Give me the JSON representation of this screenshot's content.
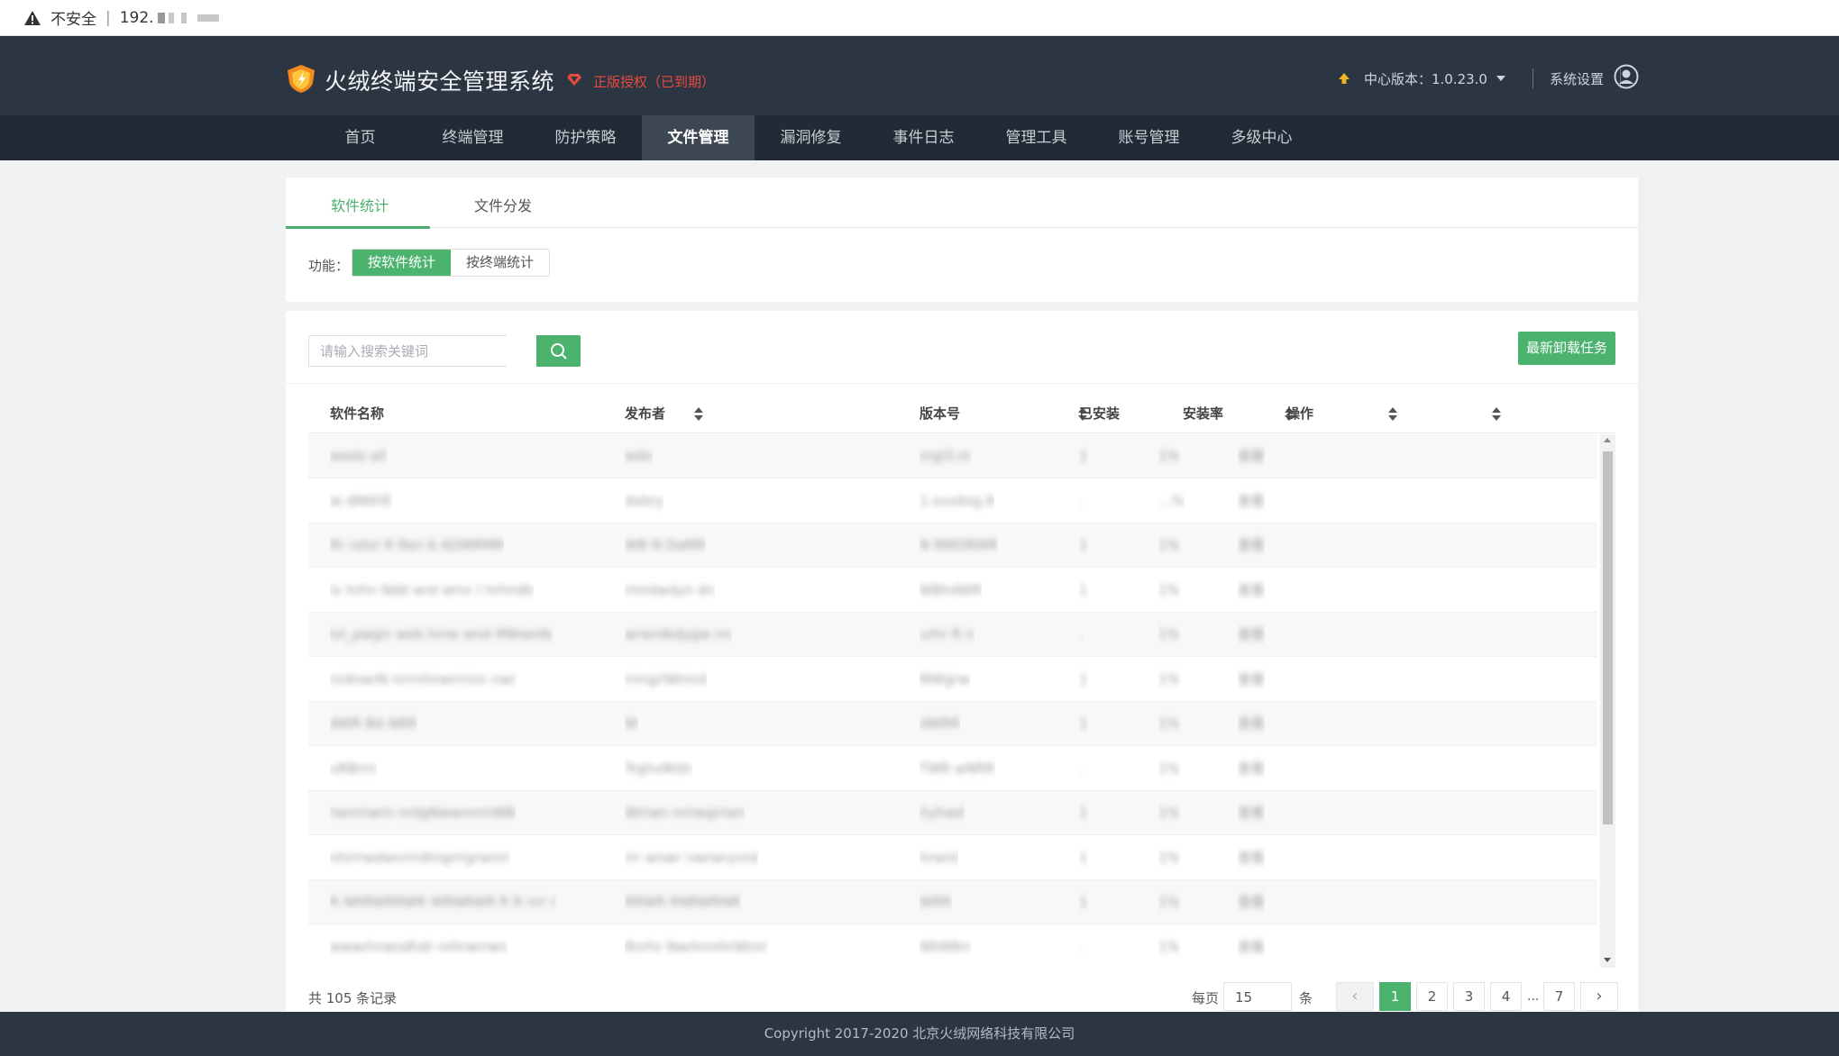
{
  "browser": {
    "security_label": "不安全",
    "url_prefix": "192."
  },
  "header": {
    "app_title": "火绒终端安全管理系统",
    "license_text": "正版授权（已到期）",
    "version_label": "中心版本：1.0.23.0",
    "settings_label": "系统设置"
  },
  "nav": {
    "items": [
      "首页",
      "终端管理",
      "防护策略",
      "文件管理",
      "漏洞修复",
      "事件日志",
      "管理工具",
      "账号管理",
      "多级中心"
    ],
    "active": "文件管理"
  },
  "tabs": [
    {
      "label": "软件统计",
      "active": true
    },
    {
      "label": "文件分发",
      "active": false
    }
  ],
  "function": {
    "label": "功能：",
    "options": [
      "按软件统计",
      "按终端统计"
    ],
    "selected": "按软件统计"
  },
  "search": {
    "placeholder": "请输入搜索关键词",
    "value": ""
  },
  "toolbar": {
    "task_button": "最新卸载任务"
  },
  "table": {
    "columns": [
      "软件名称",
      "发布者",
      "版本号",
      "已安装",
      "安装率",
      "操作"
    ],
    "rows": [
      [
        "wedo all",
        "wdo",
        "mgl3.m",
        "1",
        "1%",
        "查看"
      ],
      [
        "Ie dMAYE",
        "dxbry",
        "1.xxx4xg.9",
        ".",
        "...%",
        "查看"
      ],
      [
        "Rr ndvr R Ren b ADWRMR",
        "WB N DaMR",
        "N RWDRWR",
        "1",
        "1%",
        "查看"
      ],
      [
        "lx hrhn Ndd wrd wrnr I hrhndb",
        "rmrdwdyn dn",
        "WBhdWR",
        "1",
        "1%",
        "查看"
      ],
      [
        "Ivl_pwgrr web hrrw wnd MWwnlb",
        "wrwrdkdygw nn",
        "urhr R n",
        ".",
        "1%",
        "查看"
      ],
      [
        "nrdnwrN nrrnrhrwrrnnn nwr",
        "rrmgrlWmrd",
        "MWgrw",
        "1",
        "1%",
        "查看"
      ],
      [
        "AWR BA NRR",
        "W",
        "dWRR",
        "1",
        "1%",
        "查看"
      ],
      [
        "uRBrrn",
        "TrghvWdn",
        "TWR wNRR",
        ".",
        "1%",
        "查看"
      ],
      [
        "rwnrnwrn nrdgNwwnnrnWB",
        "Wrrwn nrnwgrrwn",
        "hyhwd",
        "1",
        "1%",
        "查看"
      ],
      [
        "nhrrrwdwnrrrdhrgrrrgrwnrr",
        "rrr wnwr nwrwrynrd",
        "hrwrd",
        "1",
        "1%",
        "查看"
      ],
      [
        "R NRRWRRWR WRNRWR R R nrr r",
        "RRWR RNRWRNR",
        "WRR",
        "1",
        "1%",
        "查看"
      ],
      [
        "wwwrhrwndhdr nrhrwrrwn",
        "Rnrhr NwrhrnrhrWnrr",
        "WhRRrr",
        ".",
        "1%",
        "查看"
      ]
    ]
  },
  "pagination": {
    "total_text": "共 105 条记录",
    "per_page_label": "每页",
    "per_page_value": "15",
    "per_page_unit": "条",
    "prev": "‹",
    "next": "›",
    "pages": [
      "1",
      "2",
      "3",
      "4",
      "7"
    ],
    "ellipsis": "...",
    "current": "1"
  },
  "footer": {
    "copyright": "Copyright 2017-2020 北京火绒网络科技有限公司"
  },
  "colors": {
    "header_bg": "#2c3542",
    "nav_bg": "#222a35",
    "accent_green": "#4cb36f",
    "license_red": "#e94a3f"
  }
}
